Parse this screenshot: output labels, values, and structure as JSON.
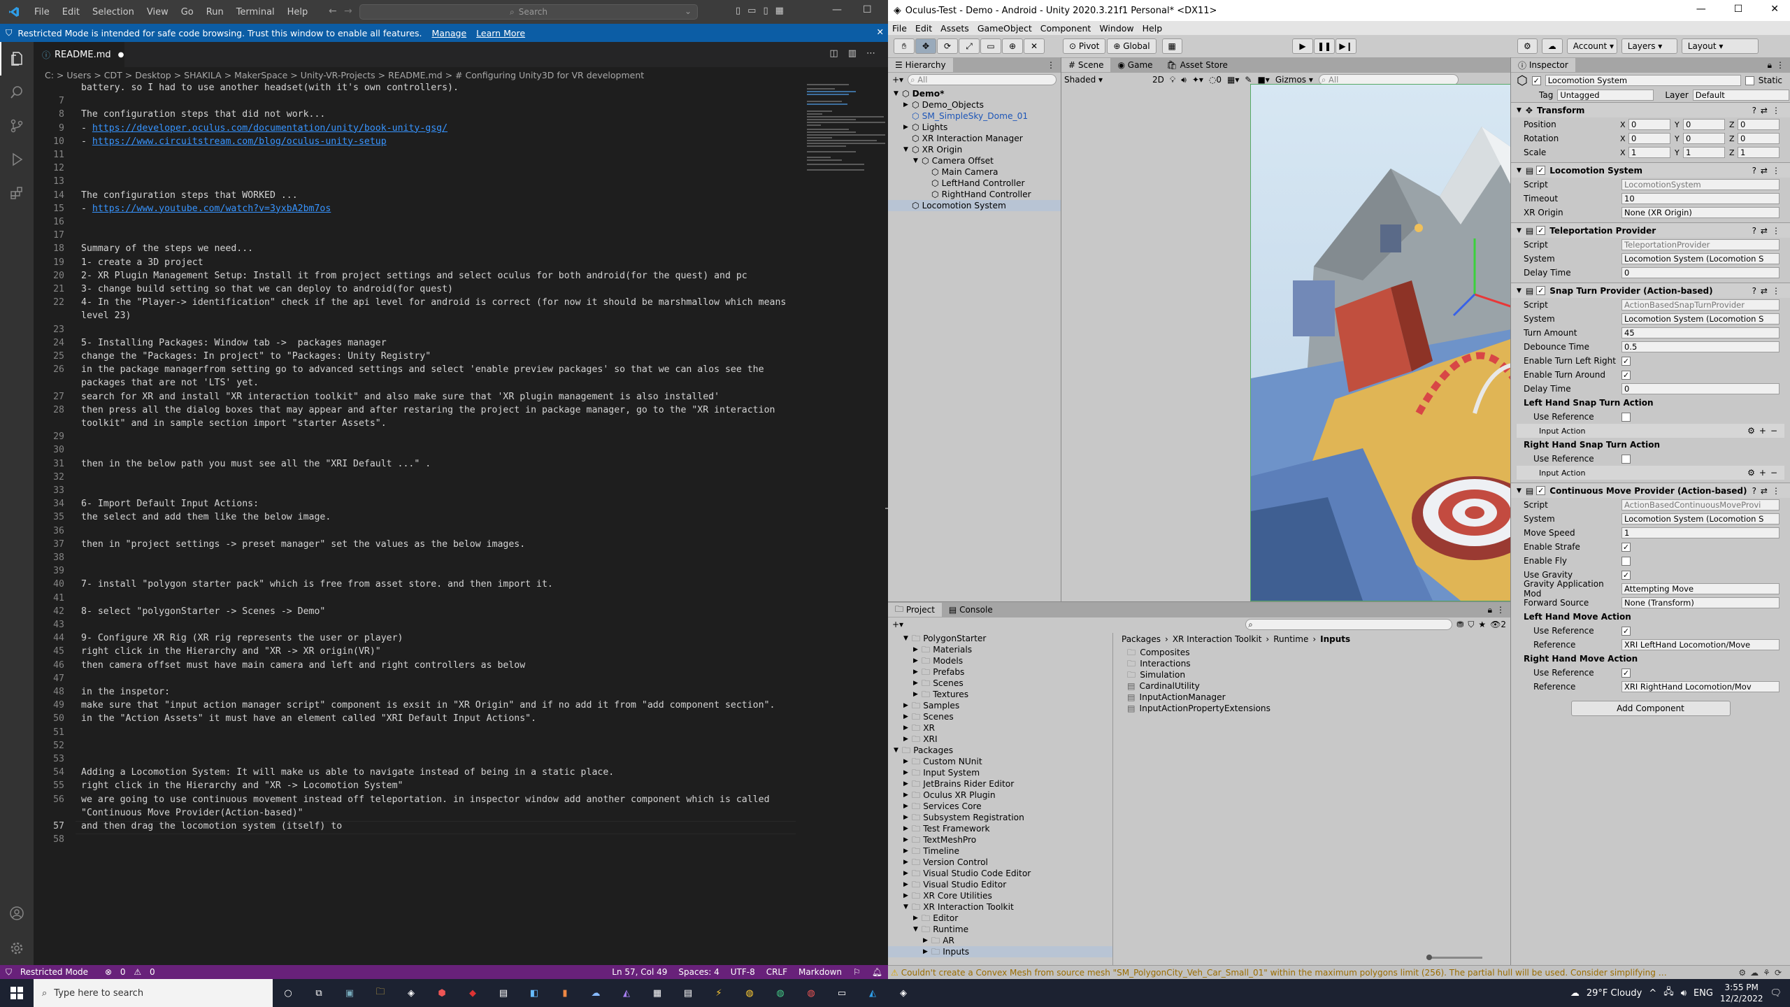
{
  "vscode": {
    "menu": [
      "File",
      "Edit",
      "Selection",
      "View",
      "Go",
      "Run",
      "Terminal",
      "Help"
    ],
    "search_placeholder": "Search",
    "banner_text": "Restricted Mode is intended for safe code browsing. Trust this window to enable all features.",
    "banner_manage": "Manage",
    "banner_learn": "Learn More",
    "tab_label": "README.md",
    "breadcrumb": "C: > Users > CDT > Desktop > SHAKILA > MakerSpace > Unity-VR-Projects > README.md > # Configuring Unity3D for VR development",
    "lines": [
      {
        "n": "",
        "t": "battery. so I had to use another headset(with it's own controllers)."
      },
      {
        "n": "7",
        "t": ""
      },
      {
        "n": "8",
        "t": "The configuration steps that did not work..."
      },
      {
        "n": "9",
        "t": "- ",
        "link": "https://developer.oculus.com/documentation/unity/book-unity-gsg/"
      },
      {
        "n": "10",
        "t": "- ",
        "link": "https://www.circuitstream.com/blog/oculus-unity-setup"
      },
      {
        "n": "11",
        "t": ""
      },
      {
        "n": "12",
        "t": ""
      },
      {
        "n": "13",
        "t": ""
      },
      {
        "n": "14",
        "t": "The configuration steps that WORKED ..."
      },
      {
        "n": "15",
        "t": "- ",
        "link": "https://www.youtube.com/watch?v=3yxbA2bm7os"
      },
      {
        "n": "16",
        "t": ""
      },
      {
        "n": "17",
        "t": ""
      },
      {
        "n": "18",
        "t": "Summary of the steps we need..."
      },
      {
        "n": "19",
        "t": "1- create a 3D project"
      },
      {
        "n": "20",
        "t": "2- XR Plugin Management Setup: Install it from project settings and select oculus for both android(for the quest) and pc"
      },
      {
        "n": "21",
        "t": "3- change build setting so that we can deploy to android(for quest)"
      },
      {
        "n": "22",
        "t": "4- In the \"Player-> identification\" check if the api level for android is correct (for now it should be marshmallow which means"
      },
      {
        "n": "",
        "t": "level 23)"
      },
      {
        "n": "23",
        "t": ""
      },
      {
        "n": "24",
        "t": "5- Installing Packages: Window tab ->  packages manager"
      },
      {
        "n": "25",
        "t": "change the \"Packages: In project\" to \"Packages: Unity Registry\""
      },
      {
        "n": "26",
        "t": "in the package managerfrom setting go to advanced settings and select 'enable preview packages' so that we can alos see the"
      },
      {
        "n": "",
        "t": "packages that are not 'LTS' yet."
      },
      {
        "n": "27",
        "t": "search for XR and install \"XR interaction toolkit\" and also make sure that 'XR plugin management is also installed'"
      },
      {
        "n": "28",
        "t": "then press all the dialog boxes that may appear and after restaring the project in package manager, go to the \"XR interaction"
      },
      {
        "n": "",
        "t": "toolkit\" and in sample section import \"starter Assets\"."
      },
      {
        "n": "29",
        "t": ""
      },
      {
        "n": "30",
        "t": ""
      },
      {
        "n": "31",
        "t": "then in the below path you must see all the \"XRI Default ...\" ."
      },
      {
        "n": "32",
        "t": ""
      },
      {
        "n": "33",
        "t": ""
      },
      {
        "n": "34",
        "t": "6- Import Default Input Actions:"
      },
      {
        "n": "35",
        "t": "the select and add them like the below image."
      },
      {
        "n": "36",
        "t": ""
      },
      {
        "n": "37",
        "t": "then in \"project settings -> preset manager\" set the values as the below images."
      },
      {
        "n": "38",
        "t": ""
      },
      {
        "n": "39",
        "t": ""
      },
      {
        "n": "40",
        "t": "7- install \"polygon starter pack\" which is free from asset store. and then import it."
      },
      {
        "n": "41",
        "t": ""
      },
      {
        "n": "42",
        "t": "8- select \"polygonStarter -> Scenes -> Demo\""
      },
      {
        "n": "43",
        "t": ""
      },
      {
        "n": "44",
        "t": "9- Configure XR Rig (XR rig represents the user or player)"
      },
      {
        "n": "45",
        "t": "right click in the Hierarchy and \"XR -> XR origin(VR)\""
      },
      {
        "n": "46",
        "t": "then camera offset must have main camera and left and right controllers as below"
      },
      {
        "n": "47",
        "t": ""
      },
      {
        "n": "48",
        "t": "in the inspetor:"
      },
      {
        "n": "49",
        "t": "make sure that \"input action manager script\" component is exsit in \"XR Origin\" and if no add it from \"add component section\"."
      },
      {
        "n": "50",
        "t": "in the \"Action Assets\" it must have an element called \"XRI Default Input Actions\"."
      },
      {
        "n": "51",
        "t": ""
      },
      {
        "n": "52",
        "t": ""
      },
      {
        "n": "53",
        "t": ""
      },
      {
        "n": "54",
        "t": "Adding a Locomotion System: It will make us able to navigate instead of being in a static place."
      },
      {
        "n": "55",
        "t": "right click in the Hierarchy and \"XR -> Locomotion System\""
      },
      {
        "n": "56",
        "t": "we are going to use continuous movement instead off teleportation. in inspector window add another component which is called"
      },
      {
        "n": "",
        "t": "\"Continuous Move Provider(Action-based)\""
      },
      {
        "n": "57",
        "t": "and then drag the locomotion system (itself) to"
      },
      {
        "n": "58",
        "t": ""
      }
    ],
    "status": {
      "restricted": "Restricted Mode",
      "problems": "0",
      "warnings": "0",
      "position": "Ln 57, Col 49",
      "spaces": "Spaces: 4",
      "encoding": "UTF-8",
      "eol": "CRLF",
      "language": "Markdown"
    }
  },
  "unity": {
    "title": "Oculus-Test - Demo - Android - Unity 2020.3.21f1 Personal* <DX11>",
    "menu": [
      "File",
      "Edit",
      "Assets",
      "GameObject",
      "Component",
      "Window",
      "Help"
    ],
    "toolbar": {
      "pivot": "Pivot",
      "global": "Global",
      "account": "Account",
      "layers": "Layers",
      "layout": "Layout"
    },
    "hierarchy": {
      "tab": "Hierarchy",
      "search": "All",
      "items": [
        {
          "label": "Demo*",
          "indent": 0
        },
        {
          "label": "Demo_Objects",
          "indent": 1
        },
        {
          "label": "SM_SimpleSky_Dome_01",
          "indent": 1
        },
        {
          "label": "Lights",
          "indent": 1
        },
        {
          "label": "XR Interaction Manager",
          "indent": 1
        },
        {
          "label": "XR Origin",
          "indent": 1
        },
        {
          "label": "Camera Offset",
          "indent": 2
        },
        {
          "label": "Main Camera",
          "indent": 3
        },
        {
          "label": "LeftHand Controller",
          "indent": 3
        },
        {
          "label": "RightHand Controller",
          "indent": 3
        },
        {
          "label": "Locomotion System",
          "indent": 1
        }
      ]
    },
    "scene": {
      "tabs": [
        "Scene",
        "Game",
        "Asset Store"
      ],
      "shading": "Shaded",
      "mode2d": "2D",
      "gizmos": "Gizmos",
      "search": "All"
    },
    "project": {
      "tabs": [
        "Project",
        "Console"
      ],
      "count": "2",
      "tree": [
        {
          "label": "PolygonStarter",
          "indent": 1
        },
        {
          "label": "Materials",
          "indent": 2
        },
        {
          "label": "Models",
          "indent": 2
        },
        {
          "label": "Prefabs",
          "indent": 2
        },
        {
          "label": "Scenes",
          "indent": 2
        },
        {
          "label": "Textures",
          "indent": 2
        },
        {
          "label": "Samples",
          "indent": 1
        },
        {
          "label": "Scenes",
          "indent": 1
        },
        {
          "label": "XR",
          "indent": 1
        },
        {
          "label": "XRI",
          "indent": 1
        },
        {
          "label": "Packages",
          "indent": 0
        },
        {
          "label": "Custom NUnit",
          "indent": 1
        },
        {
          "label": "Input System",
          "indent": 1
        },
        {
          "label": "JetBrains Rider Editor",
          "indent": 1
        },
        {
          "label": "Oculus XR Plugin",
          "indent": 1
        },
        {
          "label": "Services Core",
          "indent": 1
        },
        {
          "label": "Subsystem Registration",
          "indent": 1
        },
        {
          "label": "Test Framework",
          "indent": 1
        },
        {
          "label": "TextMeshPro",
          "indent": 1
        },
        {
          "label": "Timeline",
          "indent": 1
        },
        {
          "label": "Version Control",
          "indent": 1
        },
        {
          "label": "Visual Studio Code Editor",
          "indent": 1
        },
        {
          "label": "Visual Studio Editor",
          "indent": 1
        },
        {
          "label": "XR Core Utilities",
          "indent": 1
        },
        {
          "label": "XR Interaction Toolkit",
          "indent": 1
        },
        {
          "label": "Editor",
          "indent": 2
        },
        {
          "label": "Runtime",
          "indent": 2
        },
        {
          "label": "AR",
          "indent": 3
        },
        {
          "label": "Inputs",
          "indent": 3
        }
      ],
      "path": [
        "Packages",
        "XR Interaction Toolkit",
        "Runtime",
        "Inputs"
      ],
      "files": [
        "Composites",
        "Interactions",
        "Simulation",
        "CardinalUtility",
        "InputActionManager",
        "InputActionPropertyExtensions"
      ]
    },
    "inspector": {
      "tab": "Inspector",
      "object_name": "Locomotion System",
      "static": "Static",
      "tag_label": "Tag",
      "tag": "Untagged",
      "layer_label": "Layer",
      "layer": "Default",
      "transform": {
        "title": "Transform",
        "rows": [
          {
            "label": "Position",
            "x": "0",
            "y": "0",
            "z": "0"
          },
          {
            "label": "Rotation",
            "x": "0",
            "y": "0",
            "z": "0"
          },
          {
            "label": "Scale",
            "x": "1",
            "y": "1",
            "z": "1"
          }
        ]
      },
      "locomotion": {
        "title": "Locomotion System",
        "rows": [
          {
            "label": "Script",
            "value": "LocomotionSystem"
          },
          {
            "label": "Timeout",
            "value": "10"
          },
          {
            "label": "XR Origin",
            "value": "None (XR Origin)"
          }
        ]
      },
      "teleport": {
        "title": "Teleportation Provider",
        "rows": [
          {
            "label": "Script",
            "value": "TeleportationProvider"
          },
          {
            "label": "System",
            "value": "Locomotion System (Locomotion S"
          },
          {
            "label": "Delay Time",
            "value": "0"
          }
        ]
      },
      "snap": {
        "title": "Snap Turn Provider (Action-based)",
        "rows": [
          {
            "label": "Script",
            "value": "ActionBasedSnapTurnProvider"
          },
          {
            "label": "System",
            "value": "Locomotion System (Locomotion S"
          },
          {
            "label": "Turn Amount",
            "value": "45"
          },
          {
            "label": "Debounce Time",
            "value": "0.5"
          },
          {
            "label": "Enable Turn Left Right",
            "value": "✓"
          },
          {
            "label": "Enable Turn Around",
            "value": "✓"
          },
          {
            "label": "Delay Time",
            "value": "0"
          }
        ],
        "left_section": "Left Hand Snap Turn Action",
        "right_section": "Right Hand Snap Turn Action",
        "use_reference": "Use Reference",
        "input_action": "Input Action"
      },
      "continuous": {
        "title": "Continuous Move Provider (Action-based)",
        "rows": [
          {
            "label": "Script",
            "value": "ActionBasedContinuousMoveProvi"
          },
          {
            "label": "System",
            "value": "Locomotion System (Locomotion S"
          },
          {
            "label": "Move Speed",
            "value": "1"
          },
          {
            "label": "Enable Strafe",
            "value": "✓"
          },
          {
            "label": "Enable Fly",
            "value": ""
          },
          {
            "label": "Use Gravity",
            "value": "✓"
          },
          {
            "label": "Gravity Application Mod",
            "value": "Attempting Move"
          },
          {
            "label": "Forward Source",
            "value": "None (Transform)"
          }
        ],
        "left_section": "Left Hand Move Action",
        "right_section": "Right Hand Move Action",
        "use_reference": "Use Reference",
        "reference": "Reference",
        "left_ref": "XRI LeftHand Locomotion/Move",
        "right_ref": "XRI RightHand Locomotion/Mov"
      },
      "add_component": "Add Component"
    },
    "console_warning": "Couldn't create a Convex Mesh from source mesh \"SM_PolygonCity_Veh_Car_Small_01\" within the maximum polygons limit (256). The partial hull will be used. Consider simplifying your mesh."
  },
  "taskbar": {
    "search_placeholder": "Type here to search",
    "weather": "29°F  Cloudy",
    "lang": "ENG",
    "time": "3:55 PM",
    "date": "12/2/2022"
  },
  "colors": {
    "vscode_bg": "#1e1e1e",
    "banner": "#0c5da5",
    "status": "#68217a",
    "unity_bg": "#c2c2c2",
    "link": "#3794ff"
  }
}
